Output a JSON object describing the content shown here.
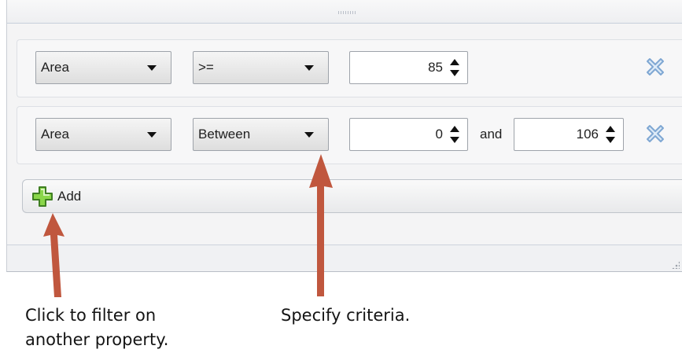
{
  "filter_rules": [
    {
      "property": "Area",
      "operator": ">=",
      "value": "85"
    },
    {
      "property": "Area",
      "operator": "Between",
      "min_value": "0",
      "joiner": "and",
      "max_value": "106"
    }
  ],
  "add_button": {
    "label": "Add",
    "icon": "plus-icon"
  },
  "icons": {
    "remove": "close-icon",
    "dropdown": "chevron-down-icon",
    "spinner": "spinner-arrows-icon"
  },
  "annotations": {
    "add_note_line1": "Click to filter on",
    "add_note_line2": "another property.",
    "criteria_note": "Specify criteria."
  },
  "colors": {
    "arrow": "#c0573e",
    "add_icon_fill": "#8ad64a",
    "remove_icon": "#8fb6de"
  }
}
